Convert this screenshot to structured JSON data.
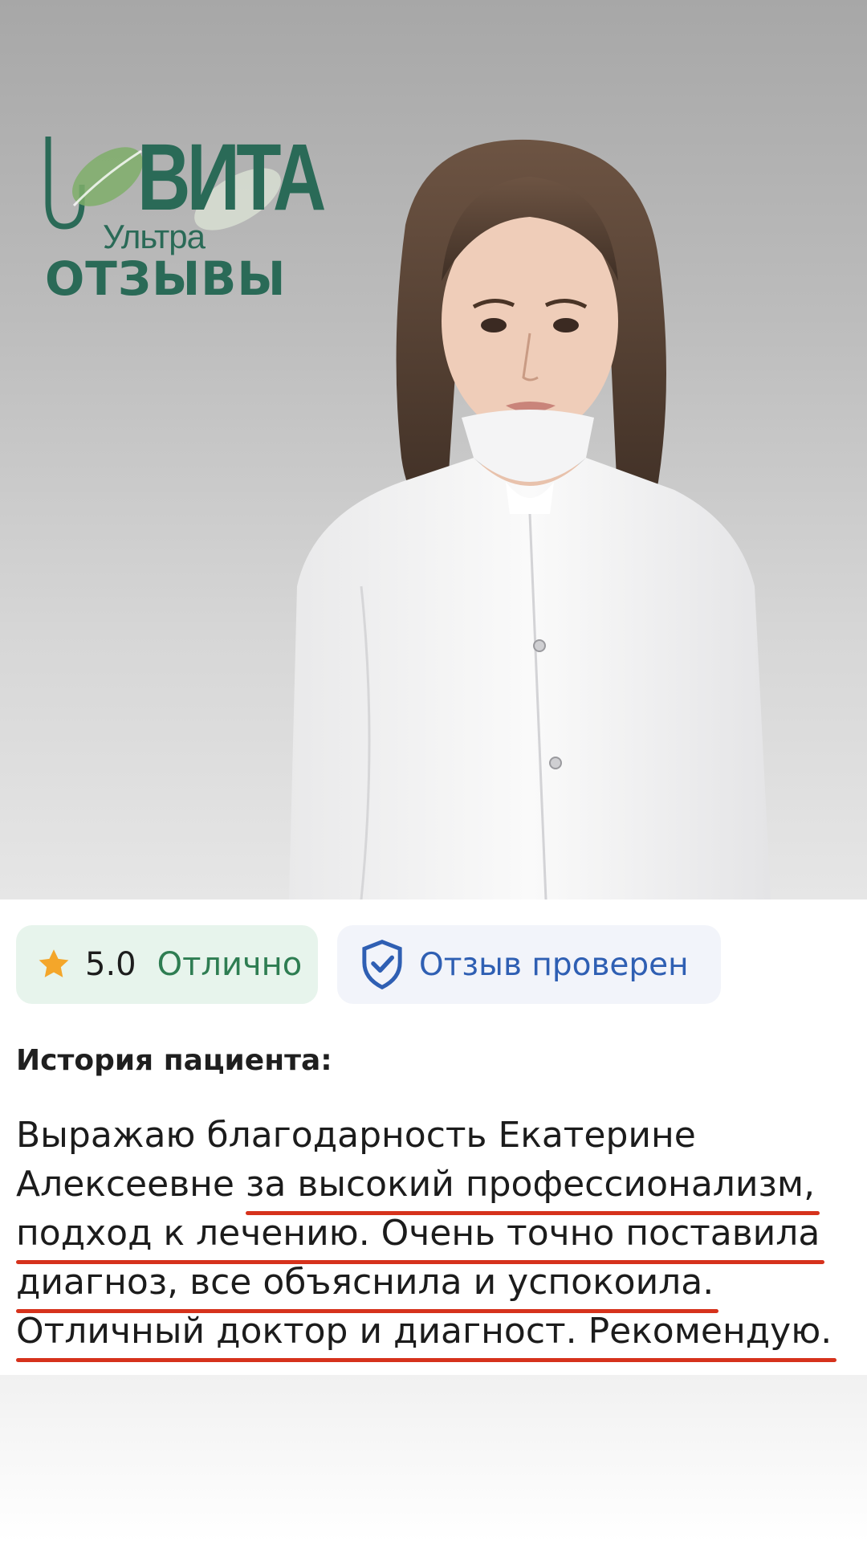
{
  "brand": {
    "wordmark": "ВИТА",
    "subtitle": "Ультра",
    "section_title": "ОТЗЫВЫ",
    "color": "#2a6a57"
  },
  "rating": {
    "value": "5.0",
    "label": "Отлично",
    "icon": "star-icon",
    "star_color": "#f4a62a"
  },
  "verified": {
    "label": "Отзыв проверен",
    "icon": "shield-check-icon",
    "color": "#2f5fb3"
  },
  "story": {
    "heading": "История пациента:",
    "lines": [
      {
        "plain": "Выражаю благодарность Екатерине",
        "highlight": ""
      },
      {
        "plain": "Алексеевне ",
        "highlight": "за высокий профессионализм,"
      },
      {
        "plain": "",
        "highlight": "подход к лечению. Очень точно поставила"
      },
      {
        "plain": "",
        "highlight": "диагноз, все объяснила и успокоила."
      },
      {
        "plain": "",
        "highlight": "Отличный доктор и диагност. Рекомендую."
      }
    ],
    "highlight_color": "#d6321c"
  }
}
